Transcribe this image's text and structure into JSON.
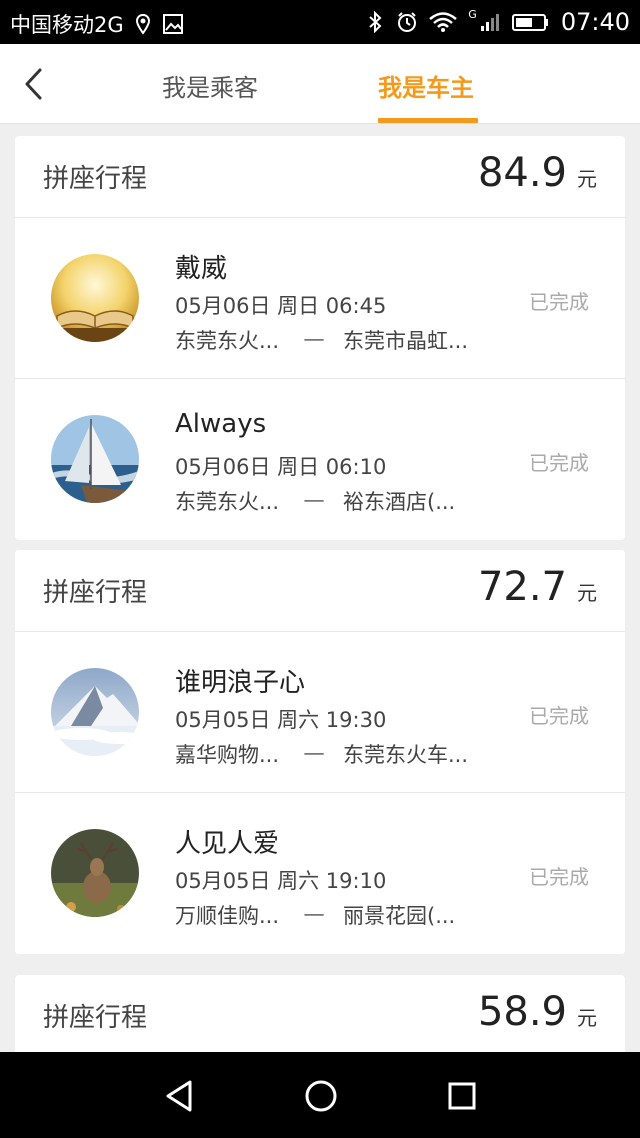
{
  "status_bar": {
    "carrier": "中国移动2G",
    "network": "G",
    "time": "07:40"
  },
  "header": {
    "tabs": [
      {
        "label": "我是乘客",
        "active": false
      },
      {
        "label": "我是车主",
        "active": true
      }
    ],
    "accent_color": "#f39a1d"
  },
  "cards": [
    {
      "title": "拼座行程",
      "price": "84.9",
      "unit": "元",
      "trips": [
        {
          "name": "戴威",
          "datetime": "05月06日 周日 06:45",
          "from": "东莞东火...",
          "to": "东莞市晶虹...",
          "status": "已完成",
          "avatar": "book-avatar"
        },
        {
          "name": "Always",
          "datetime": "05月06日 周日 06:10",
          "from": "东莞东火...",
          "to": "裕东酒店(...",
          "status": "已完成",
          "avatar": "sailboat-avatar"
        }
      ]
    },
    {
      "title": "拼座行程",
      "price": "72.7",
      "unit": "元",
      "trips": [
        {
          "name": "谁明浪子心",
          "datetime": "05月05日 周六 19:30",
          "from": "嘉华购物...",
          "to": "东莞东火车...",
          "status": "已完成",
          "avatar": "mountain-avatar"
        },
        {
          "name": "人见人爱",
          "datetime": "05月05日 周六 19:10",
          "from": "万顺佳购...",
          "to": "丽景花园(...",
          "status": "已完成",
          "avatar": "deer-avatar"
        }
      ]
    },
    {
      "title": "拼座行程",
      "price": "58.9",
      "unit": "元",
      "trips": []
    }
  ],
  "route_separator": "一"
}
